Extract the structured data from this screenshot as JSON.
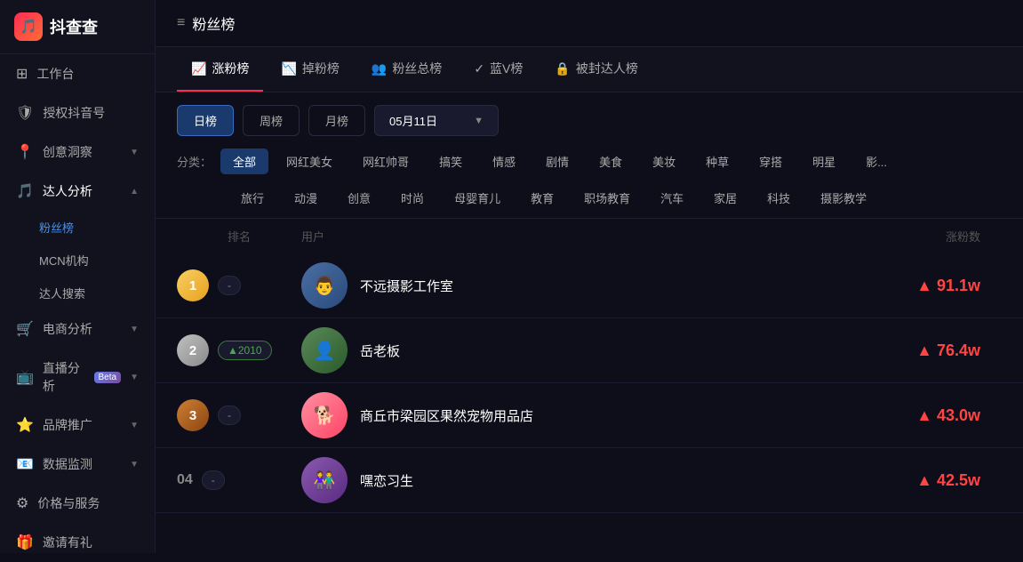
{
  "app": {
    "name": "抖查查",
    "logo_emoji": "🎵"
  },
  "header": {
    "icon": "≡",
    "title": "粉丝榜"
  },
  "sidebar": {
    "items": [
      {
        "id": "workspace",
        "label": "工作台",
        "icon": "⊞",
        "has_arrow": false
      },
      {
        "id": "auth",
        "label": "授权抖音号",
        "icon": "🛡",
        "has_arrow": false
      },
      {
        "id": "insight",
        "label": "创意洞察",
        "icon": "📍",
        "has_arrow": true
      },
      {
        "id": "creator",
        "label": "达人分析",
        "icon": "🎵",
        "has_arrow": true,
        "expanded": true
      },
      {
        "id": "fans",
        "label": "粉丝榜",
        "icon": "",
        "is_sub": true,
        "active": true
      },
      {
        "id": "mcn",
        "label": "MCN机构",
        "icon": "",
        "is_sub": true
      },
      {
        "id": "search",
        "label": "达人搜索",
        "icon": "",
        "is_sub": true
      },
      {
        "id": "ecommerce",
        "label": "电商分析",
        "icon": "🛒",
        "has_arrow": true
      },
      {
        "id": "live",
        "label": "直播分析",
        "icon": "📺",
        "has_arrow": true,
        "has_beta": true
      },
      {
        "id": "brand",
        "label": "品牌推广",
        "icon": "⭐",
        "has_arrow": true
      },
      {
        "id": "monitor",
        "label": "数据监测",
        "icon": "📧",
        "has_arrow": true
      },
      {
        "id": "pricing",
        "label": "价格与服务",
        "icon": "⚙",
        "has_arrow": false
      },
      {
        "id": "invite",
        "label": "邀请有礼",
        "icon": "🎁",
        "has_arrow": false
      }
    ]
  },
  "tabs": [
    {
      "id": "rise",
      "label": "涨粉榜",
      "icon": "📈",
      "active": true,
      "color": "#fe2c55"
    },
    {
      "id": "drop",
      "label": "掉粉榜",
      "icon": "📉",
      "active": false
    },
    {
      "id": "total",
      "label": "粉丝总榜",
      "icon": "👥",
      "active": false
    },
    {
      "id": "bluev",
      "label": "蓝V榜",
      "icon": "✓",
      "active": false
    },
    {
      "id": "locked",
      "label": "被封达人榜",
      "icon": "🔒",
      "active": false
    }
  ],
  "period_buttons": [
    {
      "id": "daily",
      "label": "日榜",
      "active": true
    },
    {
      "id": "weekly",
      "label": "周榜",
      "active": false
    },
    {
      "id": "monthly",
      "label": "月榜",
      "active": false
    }
  ],
  "date_selector": {
    "value": "05月11日",
    "arrow": "▼"
  },
  "categories_label": "分类：",
  "categories_row1": [
    {
      "id": "all",
      "label": "全部",
      "active": true
    },
    {
      "id": "beauty",
      "label": "网红美女",
      "active": false
    },
    {
      "id": "handsome",
      "label": "网红帅哥",
      "active": false
    },
    {
      "id": "funny",
      "label": "搞笑",
      "active": false
    },
    {
      "id": "emotion",
      "label": "情感",
      "active": false
    },
    {
      "id": "drama",
      "label": "剧情",
      "active": false
    },
    {
      "id": "food",
      "label": "美食",
      "active": false
    },
    {
      "id": "makeup",
      "label": "美妆",
      "active": false
    },
    {
      "id": "grass",
      "label": "种草",
      "active": false
    },
    {
      "id": "fashion",
      "label": "穿搭",
      "active": false
    },
    {
      "id": "celeb",
      "label": "明星",
      "active": false
    },
    {
      "id": "more",
      "label": "影...",
      "active": false
    }
  ],
  "categories_row2": [
    {
      "id": "travel",
      "label": "旅行",
      "active": false
    },
    {
      "id": "anime",
      "label": "动漫",
      "active": false
    },
    {
      "id": "creative",
      "label": "创意",
      "active": false
    },
    {
      "id": "style",
      "label": "时尚",
      "active": false
    },
    {
      "id": "parenting",
      "label": "母婴育儿",
      "active": false
    },
    {
      "id": "education",
      "label": "教育",
      "active": false
    },
    {
      "id": "career",
      "label": "职场教育",
      "active": false
    },
    {
      "id": "car",
      "label": "汽车",
      "active": false
    },
    {
      "id": "home",
      "label": "家居",
      "active": false
    },
    {
      "id": "tech",
      "label": "科技",
      "active": false
    },
    {
      "id": "photo",
      "label": "摄影教学",
      "active": false
    }
  ],
  "table": {
    "headers": {
      "rank": "排名",
      "user": "用户",
      "fans": "涨粉数"
    },
    "rows": [
      {
        "rank": "1",
        "medal": "gold",
        "badge": null,
        "badge_text": "-",
        "user_name": "不远摄影工作室",
        "avatar_emoji": "👨",
        "fans_change": "▲ 91.1w"
      },
      {
        "rank": "2",
        "medal": "silver",
        "badge": "up",
        "badge_text": "▲2010",
        "user_name": "岳老板",
        "avatar_emoji": "👤",
        "fans_change": "▲ 76.4w"
      },
      {
        "rank": "3",
        "medal": "bronze",
        "badge": null,
        "badge_text": "-",
        "user_name": "商丘市梁园区果然宠物用品店",
        "avatar_emoji": "🐕",
        "fans_change": "▲ 43.0w"
      },
      {
        "rank": "04",
        "medal": null,
        "badge": null,
        "badge_text": "-",
        "user_name": "嘿恋习生",
        "avatar_emoji": "👫",
        "fans_change": "▲ 42.5w"
      }
    ]
  },
  "colors": {
    "accent_red": "#fe2c55",
    "fans_up": "#ff4444",
    "active_blue": "#1a3a6e",
    "sidebar_bg": "#12121f",
    "main_bg": "#0e0e1a"
  }
}
